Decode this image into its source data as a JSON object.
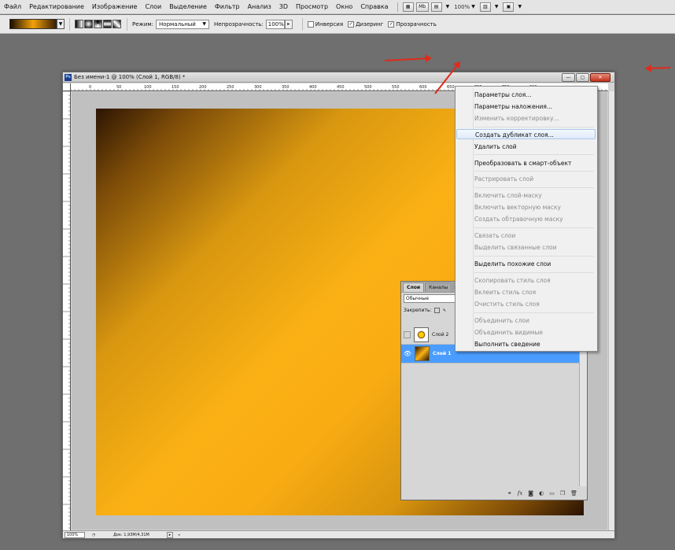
{
  "menubar": {
    "items": [
      "Файл",
      "Редактирование",
      "Изображение",
      "Слои",
      "Выделение",
      "Фильтр",
      "Анализ",
      "3D",
      "Просмотр",
      "Окно",
      "Справка"
    ],
    "mb_label": "Mb",
    "zoom": "100%"
  },
  "options": {
    "mode_label": "Режим:",
    "mode_value": "Нормальный",
    "opacity_label": "Непрозрачность:",
    "opacity_value": "100%",
    "reverse_label": "Инверсия",
    "dither_label": "Дизеринг",
    "transparency_label": "Прозрачность",
    "reverse_checked": false,
    "dither_checked": true,
    "transparency_checked": true
  },
  "document": {
    "title": "Без имени-1 @ 100% (Слой 1, RGB/8) *",
    "ruler_h": [
      "0",
      "50",
      "100",
      "150",
      "200",
      "250",
      "300",
      "350",
      "400",
      "450",
      "500",
      "550",
      "600",
      "650",
      "700",
      "750",
      "800"
    ],
    "zoom": "100%",
    "doc_size": "Док: 1,93M/4,31M"
  },
  "layers": {
    "tabs": [
      "Слои",
      "Каналы",
      "Контуры"
    ],
    "blend_mode": "Обычные",
    "lock_label": "Закрепить:",
    "rows": [
      {
        "name": "Слой 2",
        "visible": false,
        "selected": false
      },
      {
        "name": "Слой 1",
        "visible": true,
        "selected": true
      }
    ],
    "footer_icons": [
      "link-icon",
      "fx-icon",
      "mask-icon",
      "adjustment-icon",
      "group-icon",
      "new-layer-icon",
      "trash-icon"
    ]
  },
  "context_menu": {
    "items": [
      {
        "label": "Параметры слоя...",
        "disabled": false
      },
      {
        "label": "Параметры наложения...",
        "disabled": false
      },
      {
        "label": "Изменить корректировку...",
        "disabled": true
      },
      {
        "label": "Создать дубликат слоя...",
        "disabled": false,
        "hover": true
      },
      {
        "label": "Удалить слой",
        "disabled": false
      },
      {
        "label": "Преобразовать в смарт-объект",
        "disabled": false
      },
      {
        "label": "Растрировать слой",
        "disabled": true
      },
      {
        "label": "Включить слой-маску",
        "disabled": true
      },
      {
        "label": "Включить векторную маску",
        "disabled": true
      },
      {
        "label": "Создать обтравочную маску",
        "disabled": true
      },
      {
        "label": "Связать слои",
        "disabled": true
      },
      {
        "label": "Выделить связанные слои",
        "disabled": true
      },
      {
        "label": "Выделить похожие слои",
        "disabled": false
      },
      {
        "label": "Скопировать стиль слоя",
        "disabled": true
      },
      {
        "label": "Вклеить стиль слоя",
        "disabled": true
      },
      {
        "label": "Очистить стиль слоя",
        "disabled": true
      },
      {
        "label": "Объединить слои",
        "disabled": true
      },
      {
        "label": "Объединить видимые",
        "disabled": true
      },
      {
        "label": "Выполнить сведение",
        "disabled": false
      }
    ]
  },
  "colors": {
    "selection": "#4a9dff",
    "annotation": "#e02a1a",
    "gradient_dark": "#2c1503",
    "gradient_light": "#fbb114"
  }
}
